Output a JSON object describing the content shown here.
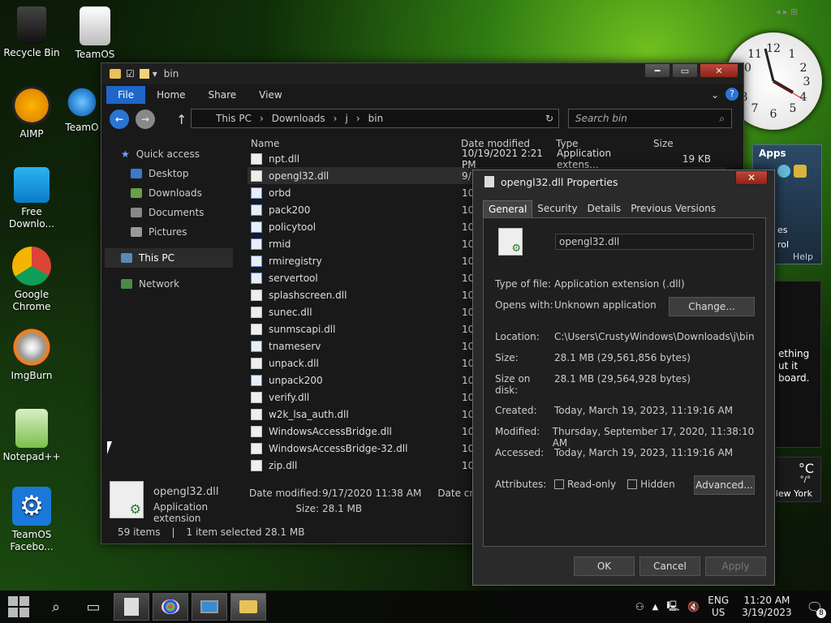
{
  "desktop": {
    "icons": [
      {
        "label": "Recycle Bin"
      },
      {
        "label": "TeamOS"
      },
      {
        "label": "AIMP"
      },
      {
        "label": "TeamO"
      },
      {
        "label": "Free Downlo..."
      },
      {
        "label": "Google Chrome"
      },
      {
        "label": "ImgBurn"
      },
      {
        "label": "Notepad++"
      },
      {
        "label": "TeamOS Facebo..."
      }
    ]
  },
  "explorer": {
    "title": "bin",
    "ribbon_tabs": [
      "File",
      "Home",
      "Share",
      "View"
    ],
    "address": [
      "This PC",
      "Downloads",
      "j",
      "bin"
    ],
    "search_placeholder": "Search bin",
    "nav": [
      {
        "label": "Quick access"
      },
      {
        "label": "Desktop"
      },
      {
        "label": "Downloads"
      },
      {
        "label": "Documents"
      },
      {
        "label": "Pictures"
      },
      {
        "label": "This PC"
      },
      {
        "label": "Network"
      }
    ],
    "columns": [
      "Name",
      "Date modified",
      "Type",
      "Size"
    ],
    "first_row": {
      "name": "npt.dll",
      "date": "10/19/2021 2:21 PM",
      "type": "Application extens...",
      "size": "19 KB"
    },
    "files": [
      {
        "name": "opengl32.dll",
        "date": "9/"
      },
      {
        "name": "orbd",
        "date": "10"
      },
      {
        "name": "pack200",
        "date": "10"
      },
      {
        "name": "policytool",
        "date": "10"
      },
      {
        "name": "rmid",
        "date": "10"
      },
      {
        "name": "rmiregistry",
        "date": "10"
      },
      {
        "name": "servertool",
        "date": "10"
      },
      {
        "name": "splashscreen.dll",
        "date": "10"
      },
      {
        "name": "sunec.dll",
        "date": "10"
      },
      {
        "name": "sunmscapi.dll",
        "date": "10"
      },
      {
        "name": "tnameserv",
        "date": "10"
      },
      {
        "name": "unpack.dll",
        "date": "10"
      },
      {
        "name": "unpack200",
        "date": "10"
      },
      {
        "name": "verify.dll",
        "date": "10"
      },
      {
        "name": "w2k_lsa_auth.dll",
        "date": "10"
      },
      {
        "name": "WindowsAccessBridge.dll",
        "date": "10"
      },
      {
        "name": "WindowsAccessBridge-32.dll",
        "date": "10"
      },
      {
        "name": "zip.dll",
        "date": "10"
      }
    ],
    "details": {
      "name": "opengl32.dll",
      "type": "Application extension",
      "date_label": "Date modified:",
      "date": "9/17/2020 11:38 AM",
      "size_label": "Size:",
      "size": "28.1 MB",
      "created_label": "Date creat"
    },
    "status": {
      "items": "59 items",
      "selected": "1 item selected  28.1 MB"
    }
  },
  "props": {
    "title": "opengl32.dll Properties",
    "tabs": [
      "General",
      "Security",
      "Details",
      "Previous Versions"
    ],
    "filename": "opengl32.dll",
    "type_label": "Type of file:",
    "type": "Application extension (.dll)",
    "opens_label": "Opens with:",
    "opens": "Unknown application",
    "change": "Change...",
    "location_label": "Location:",
    "location": "C:\\Users\\CrustyWindows\\Downloads\\j\\bin",
    "size_label": "Size:",
    "size": "28.1 MB (29,561,856 bytes)",
    "sod_label": "Size on disk:",
    "sod": "28.1 MB (29,564,928 bytes)",
    "created_label": "Created:",
    "created": "Today, March 19, 2023, 11:19:16 AM",
    "modified_label": "Modified:",
    "modified": "Thursday, September 17, 2020, 11:38:10 AM",
    "accessed_label": "Accessed:",
    "accessed": "Today, March 19, 2023, 11:19:16 AM",
    "attr_label": "Attributes:",
    "readonly": "Read-only",
    "hidden": "Hidden",
    "advanced": "Advanced...",
    "ok": "OK",
    "cancel": "Cancel",
    "apply": "Apply"
  },
  "gadgets": {
    "apps_title": "Apps",
    "apps_partial_1": "es",
    "apps_partial_2": "rol",
    "apps_help": "Help",
    "side_text": "ething\nut it\nboard.",
    "weather_temp": "°C",
    "weather_sep": "°/°",
    "weather_city": "lew York"
  },
  "tray": {
    "lang": "ENG",
    "region": "US",
    "time": "11:20 AM",
    "date": "3/19/2023",
    "notif_count": "8"
  }
}
